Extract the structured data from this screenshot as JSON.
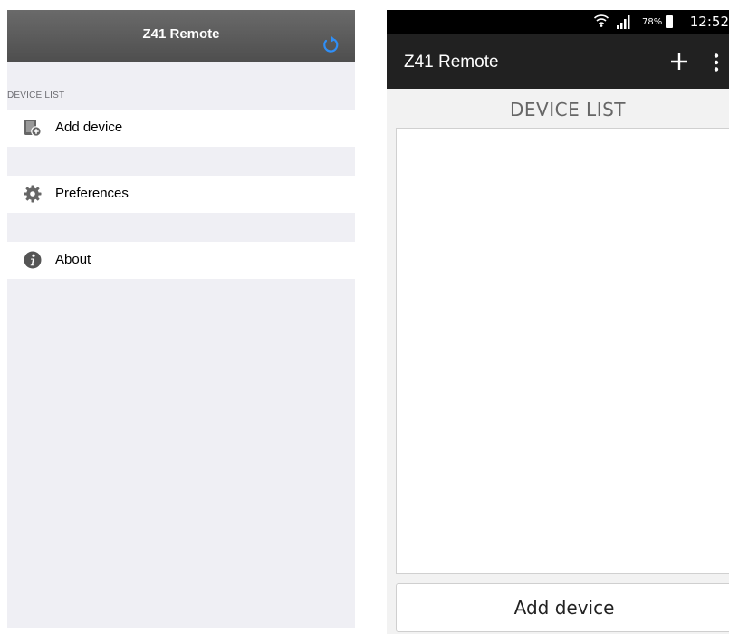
{
  "ios": {
    "nav_title": "Z41 Remote",
    "refresh_icon": "refresh-icon",
    "section_header": "DEVICE LIST",
    "items": [
      {
        "label": "Add device",
        "icon": "add-device-icon"
      },
      {
        "label": "Preferences",
        "icon": "gear-icon"
      },
      {
        "label": "About",
        "icon": "info-icon"
      }
    ]
  },
  "android": {
    "status_bar": {
      "battery_percent": "78%",
      "time": "12:52"
    },
    "actionbar": {
      "title": "Z41 Remote",
      "add_icon": "plus-icon",
      "overflow_icon": "overflow-menu-icon"
    },
    "device_list_label": "DEVICE LIST",
    "add_button_label": "Add device"
  },
  "colors": {
    "ios_nav_bg": "#5a5a5a",
    "ios_accent": "#2f8ff8",
    "ios_group_bg": "#efeff4",
    "android_actionbar_bg": "#212121",
    "android_status_bg": "#000000"
  }
}
